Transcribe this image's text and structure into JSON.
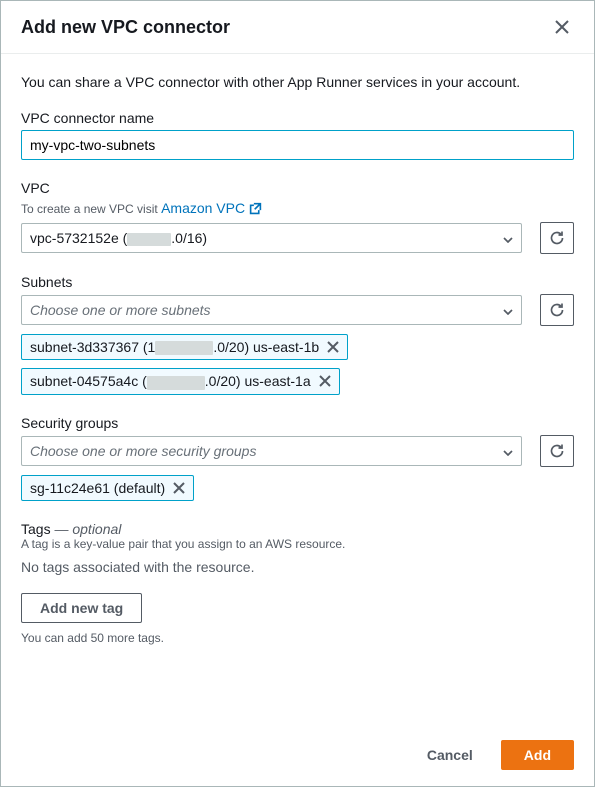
{
  "header": {
    "title": "Add new VPC connector"
  },
  "intro": "You can share a VPC connector with other App Runner services in your account.",
  "vpcConnectorName": {
    "label": "VPC connector name",
    "value": "my-vpc-two-subnets"
  },
  "vpc": {
    "label": "VPC",
    "helpText": "To create a new VPC visit ",
    "helpLink": "Amazon VPC",
    "selectedPrefix": "vpc-5732152e (",
    "selectedSuffix": ".0/16)"
  },
  "subnets": {
    "label": "Subnets",
    "placeholder": "Choose one or more subnets",
    "items": [
      {
        "prefix": "subnet-3d337367 (1",
        "suffix": ".0/20) us-east-1b"
      },
      {
        "prefix": "subnet-04575a4c (",
        "suffix": ".0/20) us-east-1a"
      }
    ]
  },
  "securityGroups": {
    "label": "Security groups",
    "placeholder": "Choose one or more security groups",
    "items": [
      {
        "label": "sg-11c24e61 (default)"
      }
    ]
  },
  "tags": {
    "header": "Tags",
    "optional": " — optional",
    "description": "A tag is a key-value pair that you assign to an AWS resource.",
    "empty": "No tags associated with the resource.",
    "addButton": "Add new tag",
    "limit": "You can add 50 more tags."
  },
  "footer": {
    "cancel": "Cancel",
    "add": "Add"
  }
}
